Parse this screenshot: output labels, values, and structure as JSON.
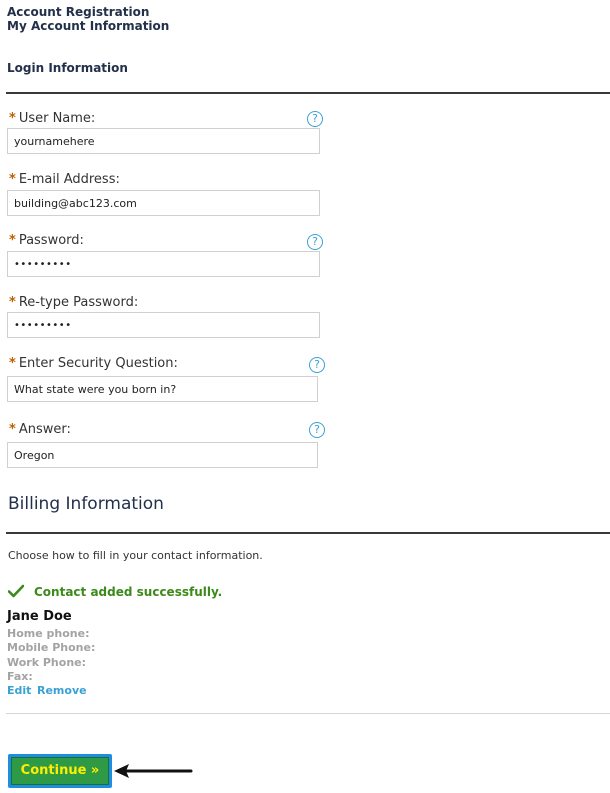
{
  "header": {
    "line1": "Account Registration",
    "line2": "My Account Information"
  },
  "login_section": {
    "title": "Login Information"
  },
  "fields": {
    "username": {
      "required_mark": "*",
      "label": "User Name:",
      "value": "yournamehere",
      "help": "?"
    },
    "email": {
      "required_mark": "*",
      "label": "E-mail Address:",
      "value": "building@abc123.com"
    },
    "password": {
      "required_mark": "*",
      "label": "Password:",
      "value": "•••••••••",
      "help": "?"
    },
    "retype_password": {
      "required_mark": "*",
      "label": "Re-type Password:",
      "value": "•••••••••"
    },
    "security_question": {
      "required_mark": "*",
      "label": "Enter Security Question:",
      "value": "What state were you born in?",
      "help": "?"
    },
    "answer": {
      "required_mark": "*",
      "label": "Answer:",
      "value": "Oregon",
      "help": "?"
    }
  },
  "billing": {
    "title": "Billing Information",
    "description": "Choose how to fill in your contact information.",
    "success_message": "Contact added successfully.",
    "contact": {
      "name": "Jane  Doe",
      "home_phone": "Home phone:",
      "mobile_phone": "Mobile Phone:",
      "work_phone": "Work Phone:",
      "fax": "Fax:"
    },
    "edit_label": "Edit",
    "remove_label": "Remove"
  },
  "continue_button": {
    "label": "Continue »"
  },
  "colors": {
    "accent_blue": "#1c8de3",
    "button_green": "#2f9a46",
    "button_text": "#ffee00",
    "success_green": "#3b8a1a",
    "link_blue": "#3aa1d4",
    "required_orange": "#c25d00"
  },
  "icons": {
    "help": "question-circle-icon",
    "success": "checkmark-icon",
    "pointer": "arrow-left-icon"
  }
}
